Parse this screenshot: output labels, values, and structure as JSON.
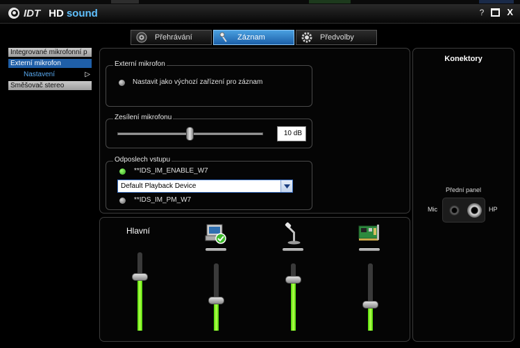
{
  "window": {
    "brand": "IDT",
    "product_hd": "HD",
    "product_sound": "sound",
    "help_label": "?",
    "close_label": "X"
  },
  "tabs": [
    {
      "label": "Přehrávání",
      "icon": "speaker-icon",
      "active": false
    },
    {
      "label": "Záznam",
      "icon": "microphone-icon",
      "active": true
    },
    {
      "label": "Předvolby",
      "icon": "gear-icon",
      "active": false
    }
  ],
  "sidebar": {
    "items": [
      {
        "label": "Integrované mikrofonní p"
      },
      {
        "label": "Externí mikrofon"
      },
      {
        "label": "Nastavení"
      },
      {
        "label": "Směšovač stereo"
      }
    ],
    "expand_arrow": "▷"
  },
  "external_mic": {
    "legend": "Externí mikrofon",
    "set_default_label": "Nastavit jako výchozí zařízení pro záznam"
  },
  "mic_boost": {
    "legend": "Zesílení mikrofonu",
    "value_text": "10 dB",
    "level_fraction": 0.5
  },
  "monitor": {
    "legend": "Odposlech vstupu",
    "enable_label": "**IDS_IM_ENABLE_W7",
    "device_selected": "Default Playback Device",
    "pm_label": "**IDS_IM_PM_W7"
  },
  "mixer": {
    "main_label": "Hlavní",
    "channels": [
      {
        "icon": "main-volume",
        "level": 0.68
      },
      {
        "icon": "default-device-icon",
        "level": 0.44
      },
      {
        "icon": "microphone-stand-icon",
        "level": 0.75
      },
      {
        "icon": "sound-card-icon",
        "level": 0.38
      }
    ]
  },
  "connectors": {
    "title": "Konektory",
    "panel_label": "Přední panel",
    "mic_label": "Mic",
    "hp_label": "HP"
  },
  "colors": {
    "accent": "#1f5fa8",
    "level_green": "#7aff20",
    "sound_blue": "#5fc0ff"
  }
}
